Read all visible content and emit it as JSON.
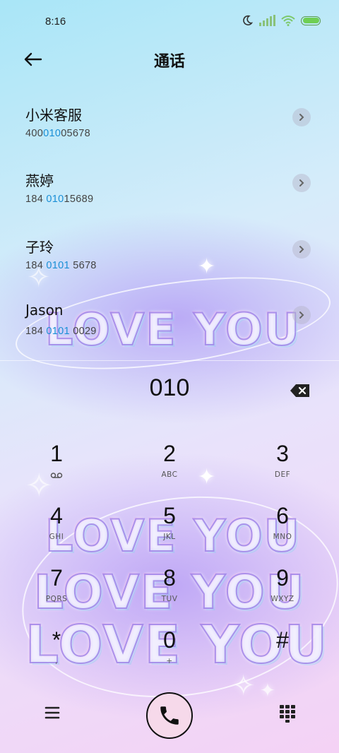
{
  "status_bar": {
    "time": "8:16"
  },
  "header": {
    "title": "通话"
  },
  "contacts": [
    {
      "name": "小米客服",
      "number_pre": "400",
      "number_match": "010",
      "number_post": "05678"
    },
    {
      "name": "燕婷",
      "number_pre": "184 ",
      "number_match": "010",
      "number_post": "15689"
    },
    {
      "name": "子玲",
      "number_pre": "184 ",
      "number_match": "0101",
      "number_post": " 5678"
    },
    {
      "name": "Jason",
      "number_pre": "184 ",
      "number_match": "0101",
      "number_post": " 0029"
    }
  ],
  "dialer": {
    "input": "010",
    "keys": [
      {
        "digit": "1",
        "letters": ""
      },
      {
        "digit": "2",
        "letters": "ABC"
      },
      {
        "digit": "3",
        "letters": "DEF"
      },
      {
        "digit": "4",
        "letters": "GHI"
      },
      {
        "digit": "5",
        "letters": "JKL"
      },
      {
        "digit": "6",
        "letters": "MNO"
      },
      {
        "digit": "7",
        "letters": "PQRS"
      },
      {
        "digit": "8",
        "letters": "TUV"
      },
      {
        "digit": "9",
        "letters": "WXYZ"
      },
      {
        "digit": "*",
        "letters": ","
      },
      {
        "digit": "0",
        "letters": "+"
      },
      {
        "digit": "#",
        "letters": ""
      }
    ]
  },
  "decoration": {
    "text": "LOVE YOU"
  },
  "colors": {
    "highlight": "#1a8fd6",
    "call_button": "#f6d9ea"
  }
}
